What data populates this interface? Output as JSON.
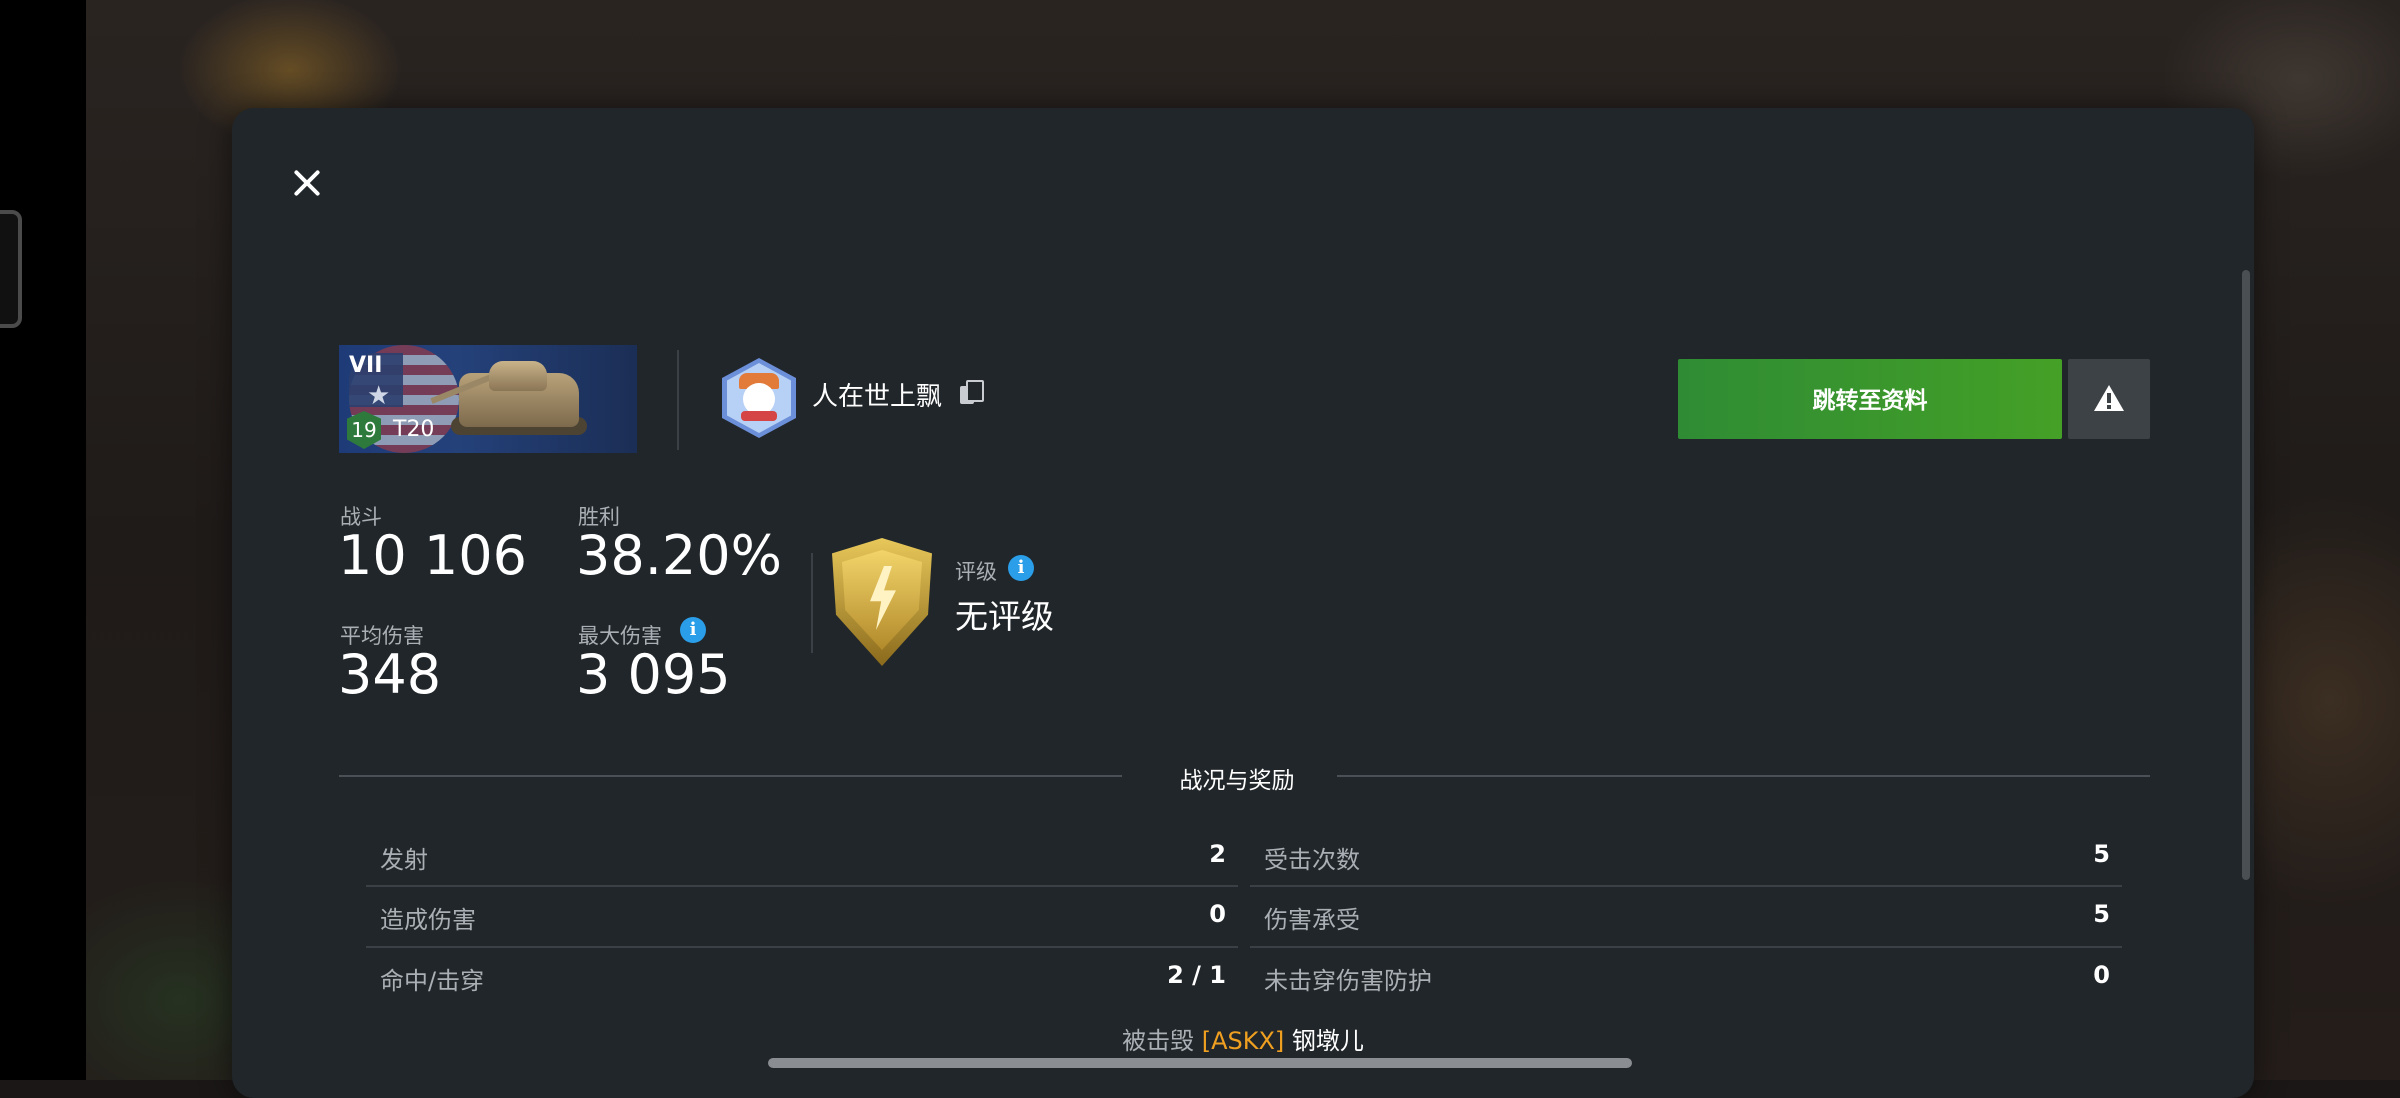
{
  "tank": {
    "tier": "VII",
    "name": "T20",
    "level": "19"
  },
  "player": {
    "name": "人在世上飘"
  },
  "buttons": {
    "go_to_profile": "跳转至资料"
  },
  "stats": {
    "battles": {
      "label": "战斗",
      "value": "10 106"
    },
    "wins": {
      "label": "胜利",
      "value": "38.20%"
    },
    "avg_damage": {
      "label": "平均伤害",
      "value": "348"
    },
    "max_damage": {
      "label": "最大伤害",
      "value": "3 095"
    }
  },
  "rating": {
    "label": "评级",
    "value": "无评级"
  },
  "section": {
    "title": "战况与奖励"
  },
  "battle_stats": {
    "left": [
      {
        "label": "发射",
        "value": "2"
      },
      {
        "label": "造成伤害",
        "value": "0"
      },
      {
        "label": "命中/击穿",
        "value": "2 / 1"
      }
    ],
    "right": [
      {
        "label": "受击次数",
        "value": "5"
      },
      {
        "label": "伤害承受",
        "value": "5"
      },
      {
        "label": "未击穿伤害防护",
        "value": "0"
      }
    ]
  },
  "destroyed_by": {
    "prefix": "被击毁",
    "clan": "[ASKX]",
    "name": "钢墩儿"
  },
  "icons": {
    "close": "close-icon",
    "copy": "copy-icon",
    "report": "warning-icon",
    "info": "info-icon"
  },
  "colors": {
    "primary_button": "#3a962c",
    "info": "#2a9ee8",
    "clan_tag": "#f0a020"
  }
}
